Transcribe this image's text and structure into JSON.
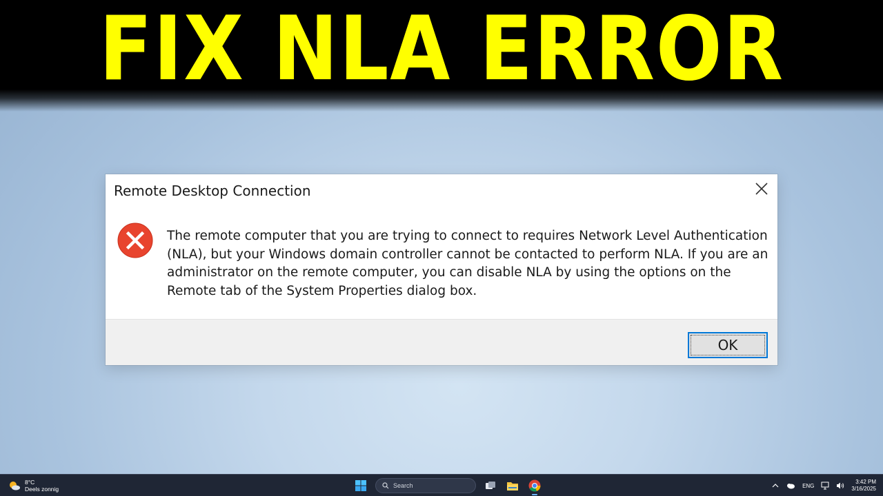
{
  "banner": {
    "title": "FIX NLA ERROR"
  },
  "dialog": {
    "title": "Remote Desktop Connection",
    "message": "The remote computer that you are trying to connect to requires Network Level Authentication (NLA), but your Windows domain controller cannot be contacted to perform NLA. If you are an administrator on the remote computer, you can disable NLA by using the options on the Remote tab of the System Properties dialog box.",
    "ok_label": "OK",
    "icon": "error-icon",
    "close_icon": "close-icon"
  },
  "taskbar": {
    "weather": {
      "temperature": "8°C",
      "condition": "Deels zonnig",
      "icon": "partly-sunny-icon"
    },
    "search": {
      "placeholder": "Search"
    },
    "pinned_apps": [
      "windows-start-icon",
      "task-view-icon",
      "file-explorer-icon",
      "chrome-icon"
    ],
    "tray": {
      "language": "ENG",
      "time": "3:42 PM",
      "date": "3/16/2025"
    }
  },
  "colors": {
    "banner_text": "#ffff00",
    "accent": "#0078d7",
    "error_red": "#e8442e",
    "taskbar": "#1f2635"
  }
}
